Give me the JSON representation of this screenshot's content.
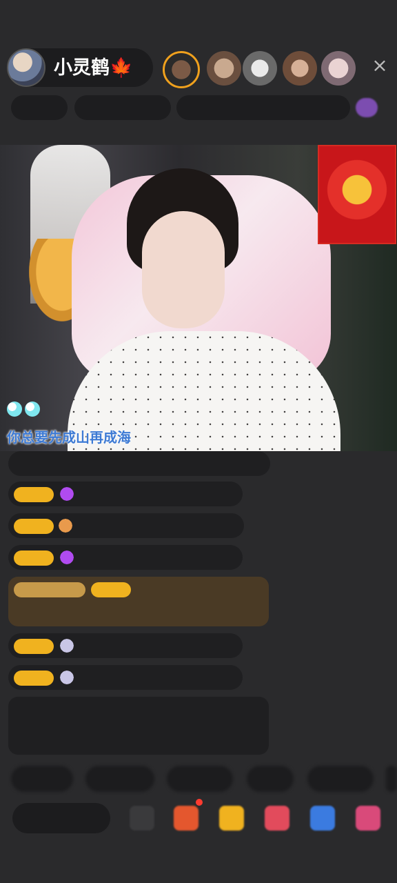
{
  "header": {
    "host_name": "小灵鹤🍁",
    "close_icon": "×"
  },
  "video": {
    "caption": "你总要先成山再成海"
  },
  "icons": {
    "close": "close-icon",
    "bubble": "bubble-icon",
    "gem": "gem-icon",
    "gift": "gift-icon",
    "emoji": "emoji-icon",
    "more": "more-icon"
  },
  "colors": {
    "badge": "#f0b21f",
    "caption": "#3d7ad4",
    "background": "#2a2a2c"
  }
}
